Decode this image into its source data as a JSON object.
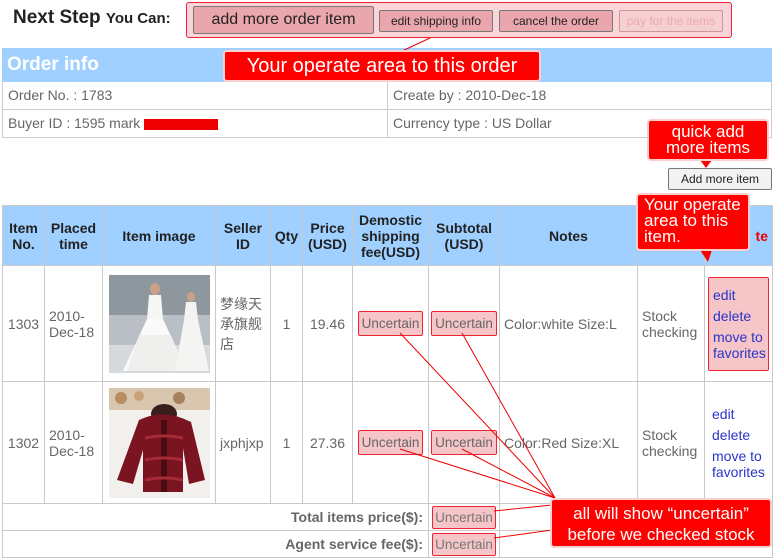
{
  "next_step": {
    "label": "Next Step",
    "suffix": "You Can:"
  },
  "actions": {
    "add_more_order_item": "add more order item",
    "edit_shipping_info": "edit shipping info",
    "cancel_the_order": "cancel the order",
    "pay_for_the_items": "pay for the items"
  },
  "callouts": {
    "operate_order": "Your operate area to this order",
    "quick_add_line1": "quick add",
    "quick_add_line2": "more items",
    "operate_item_line1": "Your operate",
    "operate_item_line2": "area to this",
    "operate_item_line3": "item.",
    "uncertain_line1": "all will show “uncertain”",
    "uncertain_line2": "before we checked stock"
  },
  "order_info": {
    "title": "Order info",
    "order_no": "Order No. : 1783",
    "create_by": "Create by : 2010-Dec-18",
    "buyer_id": "Buyer ID : 1595  mark",
    "currency": "Currency type : US Dollar"
  },
  "add_more_item_button": "Add more item",
  "table": {
    "headers": {
      "item_no": "Item No.",
      "placed_time": "Placed time",
      "item_image": "Item image",
      "seller_id": "Seller ID",
      "qty": "Qty",
      "price": "Price (USD)",
      "shipping": "Demostic shipping fee(USD)",
      "subtotal": "Subtotal (USD)",
      "notes": "Notes",
      "status_partial": "te"
    },
    "rows": [
      {
        "item_no": "1303",
        "placed_time": "2010-Dec-18",
        "image": "wedding-dress-photo",
        "seller_id": "梦缘天承旗舰店",
        "qty": "1",
        "price": "19.46",
        "shipping": "Uncertain",
        "subtotal": "Uncertain",
        "notes": "Color:white Size:L",
        "status": "Stock checking",
        "edit": "edit",
        "delete": "delete",
        "favorites": "move to favorites"
      },
      {
        "item_no": "1302",
        "placed_time": "2010-Dec-18",
        "image": "red-jacket-photo",
        "seller_id": "jxphjxp",
        "qty": "1",
        "price": "27.36",
        "shipping": "Uncertain",
        "subtotal": "Uncertain",
        "notes": "Color:Red Size:XL",
        "status": "Stock checking",
        "edit": "edit",
        "delete": "delete",
        "favorites": "move to favorites"
      }
    ],
    "footer": {
      "total_label": "Total items price($):",
      "total_value": "Uncertain",
      "agent_label": "Agent service fee($):",
      "agent_value": "Uncertain"
    }
  },
  "colors": {
    "header_blue": "#9fd0ff",
    "callout_red": "#ff0000",
    "highlight_pink": "#f5c5c8",
    "link_blue": "#2a34c8"
  }
}
